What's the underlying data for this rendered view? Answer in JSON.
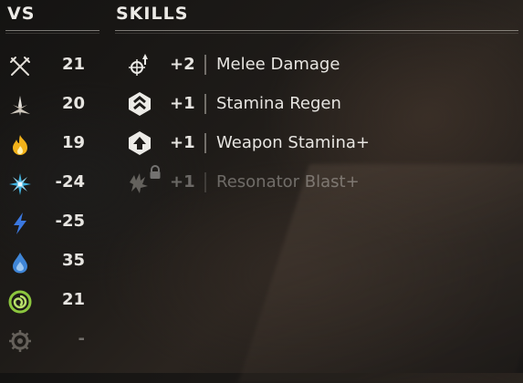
{
  "vs": {
    "header": "VS",
    "rows": [
      {
        "icon": "melee-sword-icon",
        "value": "21"
      },
      {
        "icon": "impact-burst-icon",
        "value": "20"
      },
      {
        "icon": "fire-icon",
        "value": "19"
      },
      {
        "icon": "frost-icon",
        "value": "-24"
      },
      {
        "icon": "shock-icon",
        "value": "-25"
      },
      {
        "icon": "water-drop-icon",
        "value": "35"
      },
      {
        "icon": "plasma-spiral-icon",
        "value": "21"
      },
      {
        "icon": "corruption-gear-icon",
        "value": "-"
      }
    ]
  },
  "skills": {
    "header": "SKILLS",
    "rows": [
      {
        "icon": "melee-damage-icon",
        "bonus": "+2",
        "name": "Melee Damage",
        "locked": false
      },
      {
        "icon": "stamina-regen-icon",
        "bonus": "+1",
        "name": "Stamina Regen",
        "locked": false
      },
      {
        "icon": "weapon-stamina-icon",
        "bonus": "+1",
        "name": "Weapon Stamina+",
        "locked": false
      },
      {
        "icon": "resonator-blast-icon",
        "bonus": "+1",
        "name": "Resonator Blast+",
        "locked": true
      }
    ]
  },
  "colors": {
    "fire": "#f2b21a",
    "frost": "#3fb3e0",
    "shock": "#3b78e0",
    "water": "#3f86d8",
    "plasma": "#8cc63e",
    "text": "#e7e5e1"
  }
}
